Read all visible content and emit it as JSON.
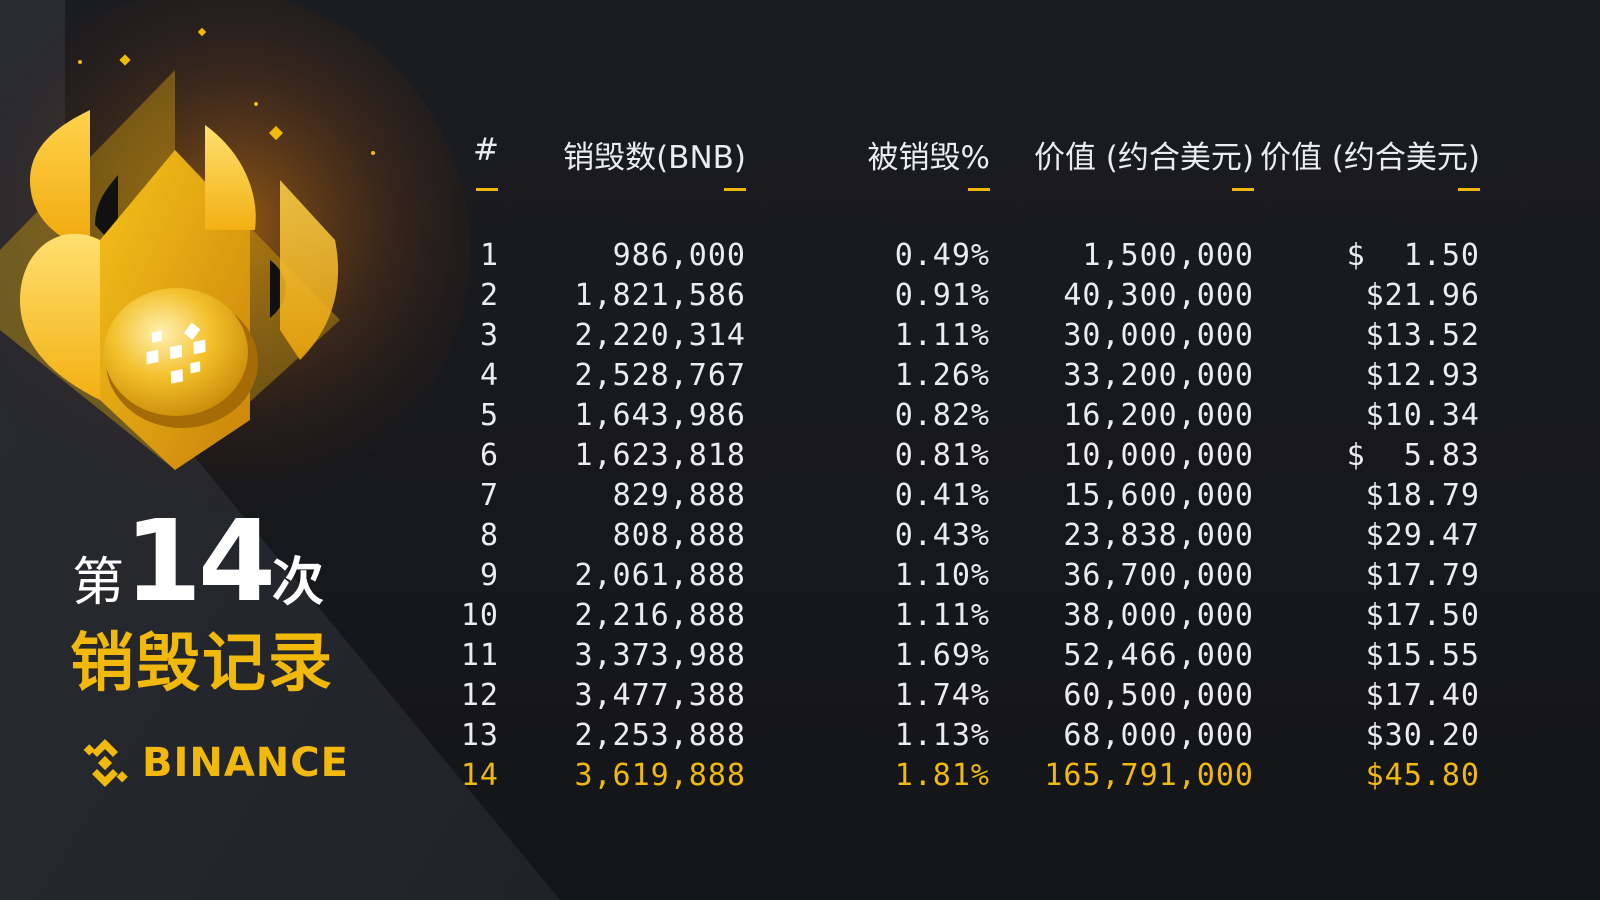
{
  "title": {
    "prefix": "第",
    "number": "14",
    "suffix": "次",
    "subtitle": "销毁记录"
  },
  "brand": {
    "name": "BINANCE",
    "icon": "binance-logo-icon"
  },
  "illustration": {
    "icon": "flame-coin-icon"
  },
  "colors": {
    "accent": "#f0b90b",
    "text": "#eaecef",
    "background": "#16171b"
  },
  "table": {
    "headers": [
      "#",
      "销毁数(BNB)",
      "被销毁%",
      "价值 (约合美元)",
      "价值 (约合美元)"
    ],
    "rows": [
      [
        "1",
        "986,000",
        "0.49%",
        "1,500,000",
        "$  1.50"
      ],
      [
        "2",
        "1,821,586",
        "0.91%",
        "40,300,000",
        "$21.96"
      ],
      [
        "3",
        "2,220,314",
        "1.11%",
        "30,000,000",
        "$13.52"
      ],
      [
        "4",
        "2,528,767",
        "1.26%",
        "33,200,000",
        "$12.93"
      ],
      [
        "5",
        "1,643,986",
        "0.82%",
        "16,200,000",
        "$10.34"
      ],
      [
        "6",
        "1,623,818",
        "0.81%",
        "10,000,000",
        "$  5.83"
      ],
      [
        "7",
        "829,888",
        "0.41%",
        "15,600,000",
        "$18.79"
      ],
      [
        "8",
        "808,888",
        "0.43%",
        "23,838,000",
        "$29.47"
      ],
      [
        "9",
        "2,061,888",
        "1.10%",
        "36,700,000",
        "$17.79"
      ],
      [
        "10",
        "2,216,888",
        "1.11%",
        "38,000,000",
        "$17.50"
      ],
      [
        "11",
        "3,373,988",
        "1.69%",
        "52,466,000",
        "$15.55"
      ],
      [
        "12",
        "3,477,388",
        "1.74%",
        "60,500,000",
        "$17.40"
      ],
      [
        "13",
        "2,253,888",
        "1.13%",
        "68,000,000",
        "$30.20"
      ],
      [
        "14",
        "3,619,888",
        "1.81%",
        "165,791,000",
        "$45.80"
      ]
    ],
    "highlight_row": 14
  }
}
